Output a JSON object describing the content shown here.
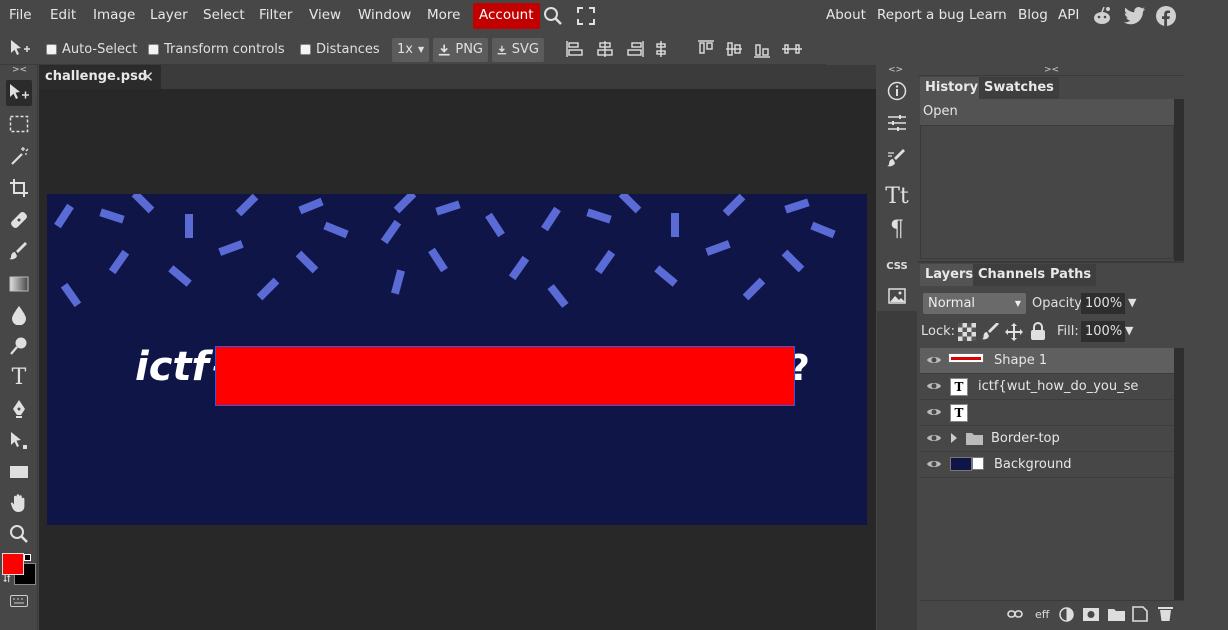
{
  "menu": {
    "left": [
      "File",
      "Edit",
      "Image",
      "Layer",
      "Select",
      "Filter",
      "View",
      "Window",
      "More"
    ],
    "account": "Account",
    "right": [
      "About",
      "Report a bug",
      "Learn",
      "Blog",
      "API"
    ]
  },
  "options": {
    "auto_select": "Auto-Select",
    "transform_controls": "Transform controls",
    "distances": "Distances",
    "zoom": "1x",
    "png": "PNG",
    "svg": "SVG"
  },
  "document": {
    "tab_name": "challenge.psd",
    "canvas_text_visible": "ictf{",
    "canvas_text_tail": "?"
  },
  "colors": {
    "accent": "#c30000",
    "canvas_bg": "#101548",
    "confetti": "#5a6bd6",
    "redaction": "#ff0000",
    "foreground": "#ff0000",
    "background": "#000000"
  },
  "panel_top": {
    "tabs": [
      "History",
      "Swatches"
    ],
    "history_items": [
      "Open"
    ]
  },
  "panel_layers": {
    "tabs": [
      "Layers",
      "Channels",
      "Paths"
    ],
    "blend_mode": "Normal",
    "opacity_label": "Opacity:",
    "opacity_value": "100%",
    "lock_label": "Lock:",
    "fill_label": "Fill:",
    "fill_value": "100%",
    "layers": [
      {
        "name": "Shape 1",
        "type": "shape",
        "selected": true
      },
      {
        "name": "ictf{wut_how_do_you_se",
        "type": "text",
        "selected": false
      },
      {
        "name": "",
        "type": "text",
        "selected": false
      },
      {
        "name": "Border-top",
        "type": "folder",
        "selected": false
      },
      {
        "name": "Background",
        "type": "image",
        "selected": false
      }
    ],
    "footer_eff": "eff"
  },
  "mini_col": {
    "css_label": "CSS"
  }
}
